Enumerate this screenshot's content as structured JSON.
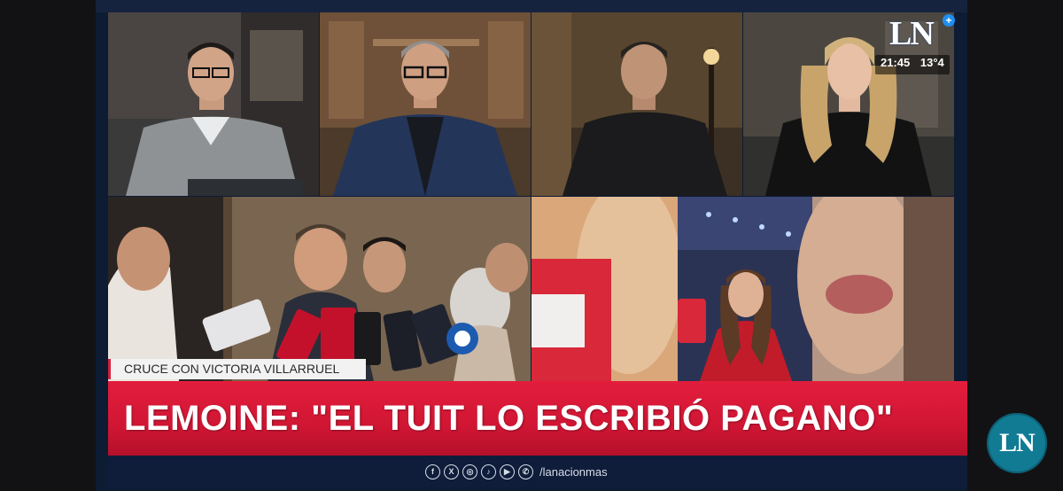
{
  "broadcast": {
    "channel_logo": "LN",
    "channel_logo_plus": "+",
    "time": "21:45",
    "temperature": "13°4",
    "kicker": "CRUCE CON VICTORIA VILLARRUEL",
    "headline": "LEMOINE: \"EL TUIT LO ESCRIBIÓ PAGANO\"",
    "social_handle": "/lanacionmas",
    "social_icons": [
      "facebook-icon",
      "x-icon",
      "instagram-icon",
      "tiktok-icon",
      "youtube-icon",
      "whatsapp-icon"
    ],
    "corner_badge": "LN"
  },
  "social_glyphs": {
    "facebook": "f",
    "x": "X",
    "instagram": "◎",
    "tiktok": "♪",
    "youtube": "▶",
    "whatsapp": "✆"
  },
  "colors": {
    "accent_red": "#d51f3c",
    "navy": "#0f1d3b",
    "badge_teal": "#117b94",
    "logo_blue": "#1e8ff0"
  }
}
